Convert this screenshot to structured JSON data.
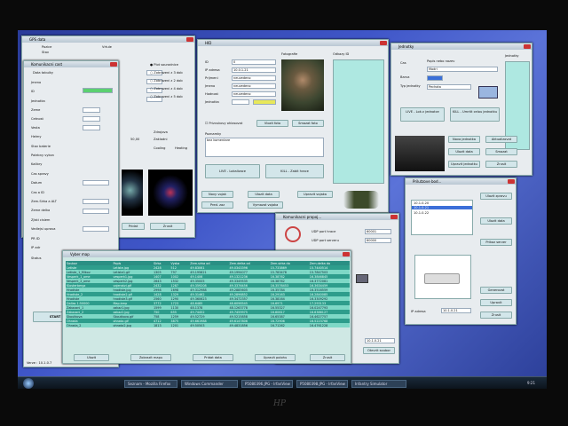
{
  "monitor": {
    "brand": "HP"
  },
  "windows": {
    "gps": {
      "title": "GPS data",
      "labels": [
        "Pozice",
        "Stav"
      ],
      "right_labels": [
        "Vrtule",
        "Zmena"
      ],
      "bottom_labels": [
        "Zdrojova",
        "Zakladni"
      ],
      "radios": [
        "Plot souradnice",
        "Zobrazeni z 3 dob",
        "Zobrazeni z 2 dob",
        "Zobrazeni z 4 dob",
        "Zobrazeni z 5 dob"
      ],
      "value": "50,00",
      "cooling": "Cooling",
      "heating": "Heating",
      "btn_add": "Pridat",
      "btn_cancel": "Zrusit"
    },
    "komunikace": {
      "title": "Komunikacni cast",
      "top": "Data tabulky",
      "labels": [
        "Jmeno",
        "ID",
        "Jednotka",
        "Zeme",
        "Cetnost",
        "Vesta",
        "Helmy",
        "Stav baterie",
        "Palebny vykon",
        "Kalibry",
        "Cas spravy",
        "Datum",
        "Cas a ID",
        "Zem.Sirka a ALT",
        "Zeme delka",
        "Zjisti cislem",
        "Vedlejsi uprava",
        "PR ID",
        "IP adr",
        "Status"
      ],
      "start": "START",
      "version": "Verze : 10.1.0.7"
    },
    "hid": {
      "title": "HID",
      "labels": [
        "ID",
        "IP adresa",
        "Prijmeni",
        "Jmeno",
        "Hodnost",
        "Jednotka"
      ],
      "values": [
        "0",
        "10.0.1.21",
        "neuvedeno",
        "neuvedeno",
        "neuvedeno",
        ""
      ],
      "photo_label": "Fotografie",
      "list_label": "Odkazy ID",
      "checkbox": "Prizvukovy ohlasovat",
      "notes_label": "Poznamky",
      "notes": "bez komentare",
      "btn_photo": "Vlozit foto",
      "btn_delete_photo": "Smazat foto",
      "btn_lw": "LIVE - Lokalizace",
      "btn_kill": "KILL - Zabit hrace",
      "btn_new": "Novy vojak",
      "btn_save": "Ulozit data",
      "btn_edit": "Upravit vojaka",
      "btn_prev": "Pred. zaz",
      "btn_del": "Vymazat vojaka"
    },
    "jednotky": {
      "title": "Jednotky",
      "labels": [
        "Cas",
        "Barva",
        "Typ jednotky"
      ],
      "header": "Popis nebo nazev",
      "field": "Modri",
      "select": "Pechota",
      "units_label": "Jednotky",
      "btn_live": "LIVE - Lok.v jednotce",
      "btn_kill": "KILL - Umrtit celou jednotku",
      "btn_new": "Nova jednotka",
      "btn_save": "Ulozit data",
      "btn_edit": "Upravit jednotku",
      "btn_refresh": "Aktualizovat",
      "btn_del": "Smazat",
      "btn_cancel": "Zrusit"
    },
    "pripojeni": {
      "title": "Komunikacni propoj...",
      "labels": [
        "UDP port hrace",
        "UDP port serveru"
      ],
      "values": [
        "60001",
        "60000"
      ],
      "ip": "10.1.0.21",
      "btn_open": "Otevrit soubor"
    },
    "prilut": {
      "title": "Prilutzove bod...",
      "items": [
        "10.1.0.20",
        "10.1.0.21",
        "10.1.0.22"
      ],
      "ip_label": "IP adresa",
      "ip": "10.1.0.21",
      "btn_send": "Ulozit zpravu",
      "btn_save": "Ulozit data",
      "btn_cmd": "Prikaz server",
      "btn_gen": "Generovat",
      "btn_edit": "Upravit",
      "btn_cancel": "Zrusit"
    },
    "mapy": {
      "title": "Vyber map",
      "columns": [
        "Soubor",
        "Popis",
        "Sirka",
        "Vyska",
        "Zem.sirka od",
        "Zem.delka od",
        "Zem.sirka do",
        "Zem.delka do"
      ],
      "rows": [
        [
          "Letiste",
          "Letiste.jpg",
          "2428",
          "512",
          "49.83061",
          "49.0343396",
          "15.733869",
          "15.7440514"
        ],
        [
          "Letiste_1_Mikov",
          "Letiste1.gif",
          "1305",
          "797",
          "49.195821",
          "49.1994077",
          "15.783478",
          "15.7847503"
        ],
        [
          "Vesperk_1_ome",
          "vesperk1.jpg",
          "1407",
          "1002",
          "49.1406",
          "49.1321236",
          "16.38762",
          "16.3846845"
        ],
        [
          "Vesperk_2_ome",
          "vesperk2.jpg",
          "2643",
          "1532",
          "49.35005",
          "49.3349535",
          "16.38762",
          "16.3772081"
        ],
        [
          "Klosterbergz",
          "vojenstvi.gif",
          "2432",
          "1287",
          "49.359208",
          "49.3376456",
          "16.3576453",
          "16.3634459"
        ],
        [
          "Hradiste",
          "hradiste.jpg",
          "2998",
          "1698",
          "49.312988",
          "49.2885605",
          "16.35784",
          "16.3516559"
        ],
        [
          "Hradiste_2",
          "hradiste2.gif",
          "1428",
          "1329",
          "49.31462",
          "49.2896852",
          "16.29163",
          "16.2840085"
        ],
        [
          "Hradiste",
          "hradiste3.gif",
          "2560",
          "1290",
          "49.360623",
          "49.3472357",
          "16.38164",
          "16.3309292"
        ],
        [
          "Dallas 1:50000",
          "Map.bmp",
          "3772",
          "1723",
          "48.6485",
          "48.6098545",
          "16.6971",
          "17.293133"
        ],
        [
          "Zakazani_1",
          "zakaz1.jpg",
          "1599",
          "1130",
          "48.1378",
          "48.1263778",
          "16.55327",
          "16.0247793"
        ],
        [
          "Zakazani_2",
          "zakaz2.jpg",
          "750",
          "655",
          "49.74452",
          "49.7459975",
          "16.60617",
          "16.6386127"
        ],
        [
          "Skoutkova",
          "Skoutkova.gif",
          "758",
          "1259",
          "49.52729",
          "49.5215858",
          "16.65387",
          "16.4627757"
        ],
        [
          "Ohrada",
          "ohrada.gif",
          "4712",
          "3875",
          "49.661988",
          "49.6147806",
          "16.72906",
          "16.5223768"
        ],
        [
          "Ohrada_2",
          "ohrada2.jpg",
          "1813",
          "1201",
          "49.50503",
          "49.4831856",
          "16.71262",
          "16.4761228"
        ]
      ],
      "btn_open": "Ulozit",
      "btn_load": "Zobrazit mapu",
      "btn_add": "Pridat data",
      "btn_edit": "Upravit polohu",
      "btn_cancel": "Zrusit"
    }
  },
  "taskbar": {
    "items": [
      "Seznam - Mozilla Firefox",
      "Windows Commander",
      "P5080396.JPG - IrfanView",
      "P5080398.JPG - IrfanView",
      "Infantry Simulator"
    ],
    "clock": "9:21"
  }
}
